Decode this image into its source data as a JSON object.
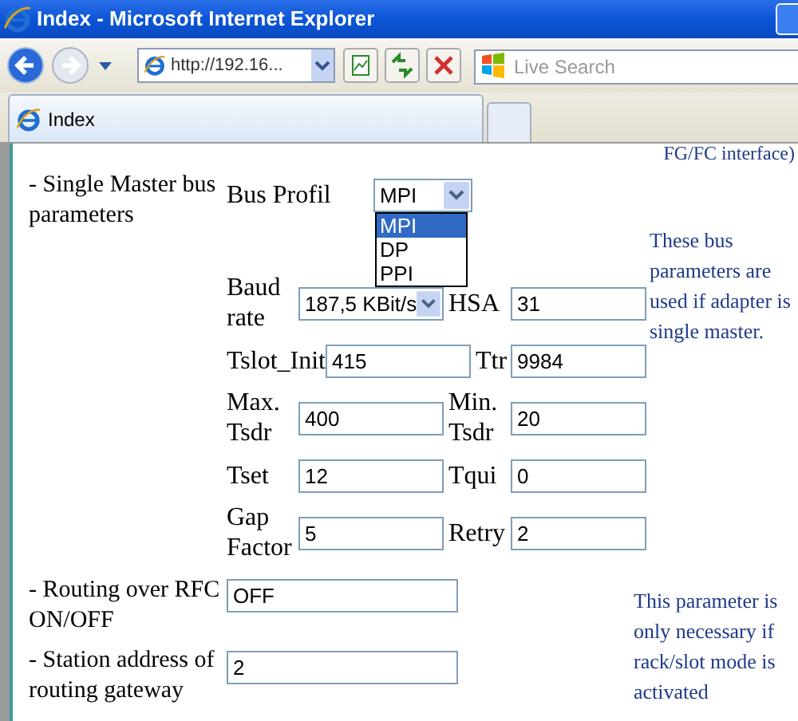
{
  "window": {
    "title": "Index - Microsoft Internet Explorer"
  },
  "toolbar": {
    "address": "http://192.16...",
    "search_placeholder": "Live Search"
  },
  "tabs": [
    {
      "label": "Index",
      "selected": true
    }
  ],
  "page": {
    "cut_text": "FG/FC interface)",
    "bus_section": {
      "label": "- Single Master bus parameters",
      "bus_profil": {
        "label": "Bus Profil",
        "value": "MPI",
        "expanded": true,
        "options": [
          {
            "label": "MPI",
            "selected": true
          },
          {
            "label": "DP",
            "selected": false
          },
          {
            "label": "PPI",
            "selected": false
          }
        ]
      },
      "rows": [
        [
          {
            "label": "Baud rate",
            "kind": "select",
            "value": "187,5 KBit/s"
          },
          {
            "label": "HSA",
            "kind": "input",
            "value": "31"
          }
        ],
        [
          {
            "label": "Tslot_Init",
            "kind": "input",
            "value": "415"
          },
          {
            "label": "Ttr",
            "kind": "input",
            "value": "9984"
          }
        ],
        [
          {
            "label": "Max. Tsdr",
            "kind": "input",
            "value": "400"
          },
          {
            "label": "Min. Tsdr",
            "kind": "input",
            "value": "20"
          }
        ],
        [
          {
            "label": "Tset",
            "kind": "input",
            "value": "12"
          },
          {
            "label": "Tqui",
            "kind": "input",
            "value": "0"
          }
        ],
        [
          {
            "label": "Gap Factor",
            "kind": "input",
            "value": "5"
          },
          {
            "label": "Retry",
            "kind": "input",
            "value": "2"
          }
        ]
      ],
      "note": "These bus parameters are used if adapter is single master."
    },
    "routing": {
      "label": "- Routing over RFC ON/OFF",
      "value": "OFF"
    },
    "station": {
      "label": "- Station address of routing gateway",
      "value": "2"
    },
    "routing_note": "This parameter is only necessary if rack/slot mode is activated"
  }
}
